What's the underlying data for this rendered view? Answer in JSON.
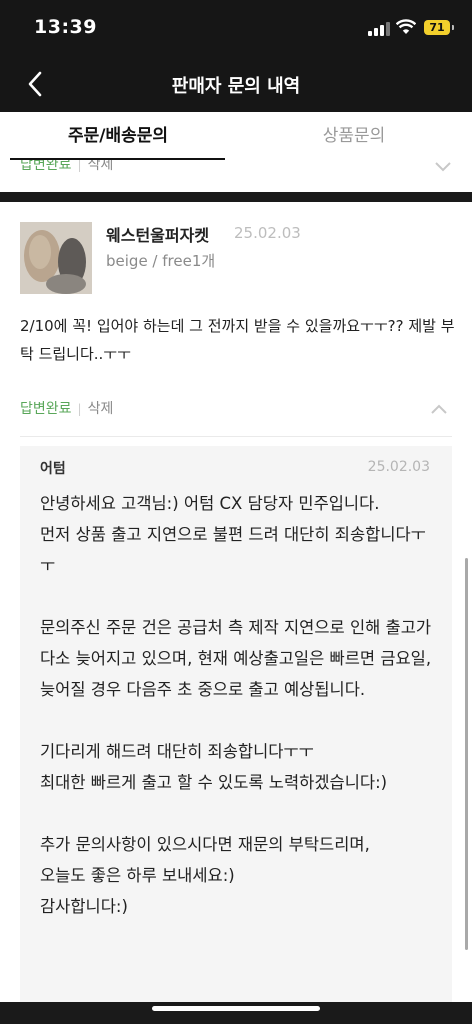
{
  "status_bar": {
    "time": "13:39",
    "battery": "71",
    "icons": [
      "signal-icon",
      "wifi-icon",
      "battery-icon"
    ]
  },
  "header": {
    "title": "판매자 문의 내역",
    "back_icon": "chevron-left-icon"
  },
  "tabs": [
    {
      "label": "주문/배송문의",
      "active": true
    },
    {
      "label": "상품문의",
      "active": false
    }
  ],
  "previous_item": {
    "status": "답변완료",
    "separator": "|",
    "delete_label": "삭제"
  },
  "inquiry": {
    "product_name": "웨스턴울퍼자켓",
    "date": "25.02.03",
    "option": "beige / free1개",
    "question": "2/10에 꼭! 입어야 하는데 그 전까지 받을 수 있을까요ㅜㅜ?? 제발 부탁 드립니다..ㅜㅜ",
    "status": "답변완료",
    "separator": "|",
    "delete_label": "삭제"
  },
  "answer": {
    "author": "어텀",
    "date": "25.02.03",
    "text": "안녕하세요 고객님:) 어텀 CX 담당자 민주입니다.\n먼저 상품 출고 지연으로 불편 드려 대단히 죄송합니다ㅜㅜ\n\n문의주신 주문 건은 공급처 측 제작 지연으로 인해 출고가 다소 늦어지고 있으며, 현재 예상출고일은 빠르면 금요일, 늦어질 경우 다음주 초 중으로 출고 예상됩니다.\n\n기다리게 해드려 대단히 죄송합니다ㅜㅜ\n최대한 빠르게 출고 할 수 있도록 노력하겠습니다:)\n\n추가 문의사항이 있으시다면 재문의 부탁드리며,\n오늘도 좋은 하루 보내세요:)\n감사합니다:)"
  },
  "colors": {
    "header_bg": "#161616",
    "answered_green": "#5aa75a",
    "battery_yellow": "#f2cf2c"
  }
}
